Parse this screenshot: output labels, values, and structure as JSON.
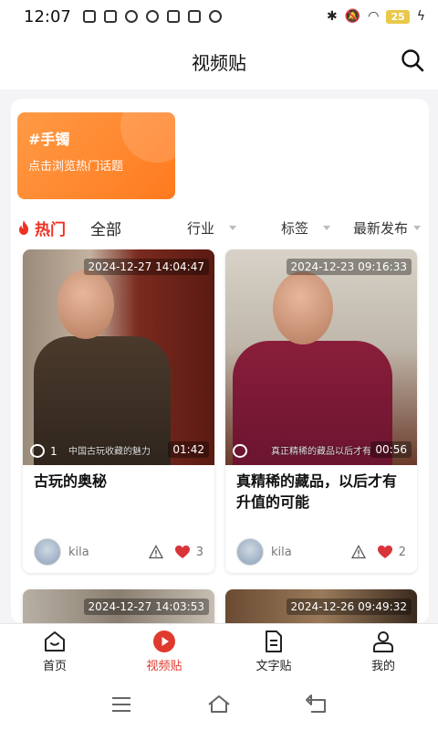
{
  "status_bar": {
    "time": "12:07",
    "battery": "25"
  },
  "header": {
    "title": "视频贴"
  },
  "topic_card": {
    "title": "#手镯",
    "subtitle": "点击浏览热门话题"
  },
  "filters": {
    "hot_label": "热门",
    "all_label": "全部",
    "industry_label": "行业",
    "tag_label": "标签",
    "sort_label": "最新发布"
  },
  "cards": [
    {
      "timestamp": "2024-12-27 14:04:47",
      "duration": "01:42",
      "comments": "1",
      "subtitle": "中国古玩收藏的魅力",
      "title": "古玩的奥秘",
      "author": "kila",
      "likes": "3"
    },
    {
      "timestamp": "2024-12-23 09:16:33",
      "duration": "00:56",
      "comments": "",
      "subtitle": "真正精稀的藏品以后才有增值",
      "title": "真精稀的藏品，以后才有升值的可能",
      "author": "kila",
      "likes": "2"
    },
    {
      "timestamp": "2024-12-27 14:03:53"
    },
    {
      "timestamp": "2024-12-26 09:49:32"
    }
  ],
  "bottom_nav": {
    "home": "首页",
    "video": "视频贴",
    "text": "文字贴",
    "mine": "我的"
  },
  "colors": {
    "accent_red": "#e03a2e",
    "topic_orange": "#ff8a2e",
    "heart": "#d8343a"
  },
  "icons": {
    "search": "search-icon",
    "fire": "fire-icon",
    "comment": "comment-bubble-icon",
    "warn": "report-warning-icon",
    "heart": "heart-icon"
  }
}
